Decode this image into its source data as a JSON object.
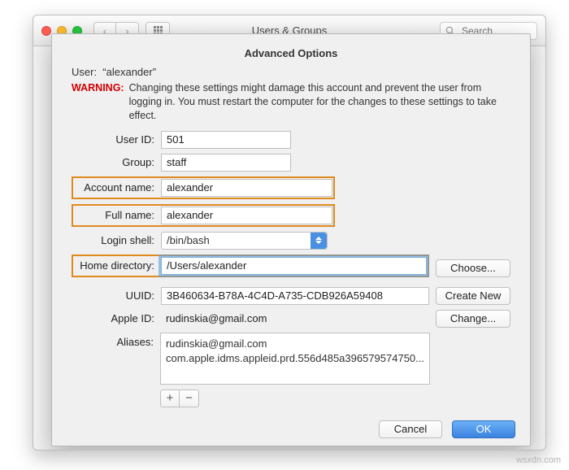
{
  "titlebar": {
    "window_title": "Users & Groups",
    "search_placeholder": "Search"
  },
  "sheet": {
    "title": "Advanced Options",
    "user_label": "User:",
    "user_value": "“alexander”",
    "warning_label": "WARNING:",
    "warning_text": "Changing these settings might damage this account and prevent the user from logging in. You must restart the computer for the changes to these settings to take effect."
  },
  "fields": {
    "user_id": {
      "label": "User ID:",
      "value": "501"
    },
    "group": {
      "label": "Group:",
      "value": "staff"
    },
    "account_name": {
      "label": "Account name:",
      "value": "alexander"
    },
    "full_name": {
      "label": "Full name:",
      "value": "alexander"
    },
    "login_shell": {
      "label": "Login shell:",
      "value": "/bin/bash"
    },
    "home_directory": {
      "label": "Home directory:",
      "value": "/Users/alexander"
    },
    "uuid": {
      "label": "UUID:",
      "value": "3B460634-B78A-4C4D-A735-CDB926A59408"
    },
    "apple_id": {
      "label": "Apple ID:",
      "value": "rudinskia@gmail.com"
    },
    "aliases": {
      "label": "Aliases:",
      "lines": [
        "rudinskia@gmail.com",
        "com.apple.idms.appleid.prd.556d485a396579574750..."
      ]
    }
  },
  "buttons": {
    "choose": "Choose...",
    "create_new": "Create New",
    "change": "Change...",
    "cancel": "Cancel",
    "ok": "OK",
    "plus": "+",
    "minus": "−"
  },
  "watermark": "wsxdn.com"
}
